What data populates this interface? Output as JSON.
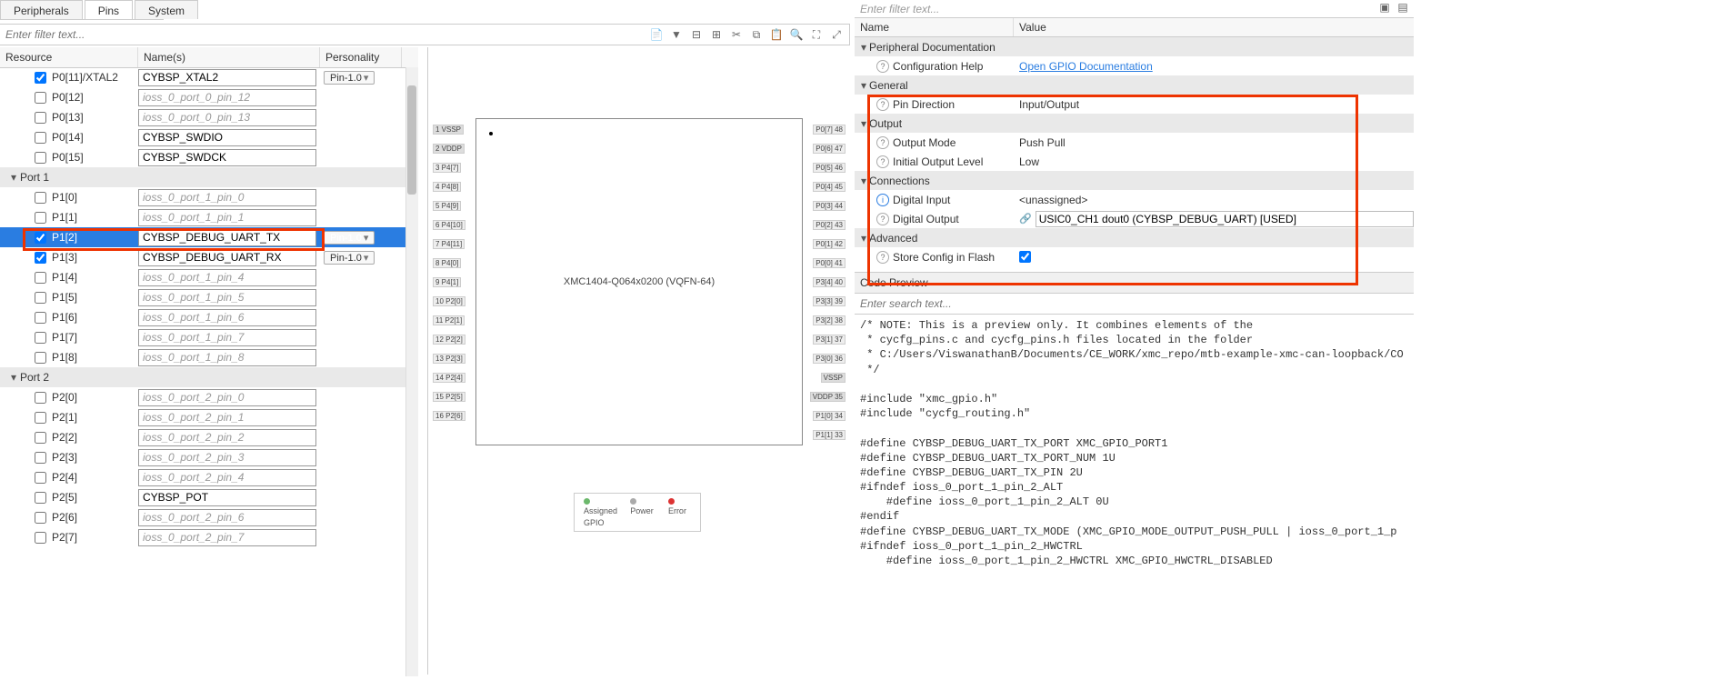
{
  "tabs": {
    "peripherals": "Peripherals",
    "pins": "Pins",
    "system": "System"
  },
  "filter": {
    "placeholder": "Enter filter text..."
  },
  "headers": {
    "resource": "Resource",
    "names": "Name(s)",
    "personality": "Personality"
  },
  "personality_label": "Pin-1.0",
  "rows": [
    {
      "type": "pin",
      "res": "P0[11]/XTAL2",
      "name": "CYBSP_XTAL2",
      "checked": true,
      "pers": true
    },
    {
      "type": "pin",
      "res": "P0[12]",
      "name": "ioss_0_port_0_pin_12",
      "placeholder": true
    },
    {
      "type": "pin",
      "res": "P0[13]",
      "name": "ioss_0_port_0_pin_13",
      "placeholder": true
    },
    {
      "type": "pin",
      "res": "P0[14]",
      "name": "CYBSP_SWDIO"
    },
    {
      "type": "pin",
      "res": "P0[15]",
      "name": "CYBSP_SWDCK"
    },
    {
      "type": "group",
      "res": "Port 1"
    },
    {
      "type": "pin",
      "res": "P1[0]",
      "name": "ioss_0_port_1_pin_0",
      "placeholder": true
    },
    {
      "type": "pin",
      "res": "P1[1]",
      "name": "ioss_0_port_1_pin_1",
      "placeholder": true
    },
    {
      "type": "pin",
      "res": "P1[2]",
      "name": "CYBSP_DEBUG_UART_TX",
      "checked": true,
      "pers": true,
      "sel": true
    },
    {
      "type": "pin",
      "res": "P1[3]",
      "name": "CYBSP_DEBUG_UART_RX",
      "checked": true,
      "pers": true
    },
    {
      "type": "pin",
      "res": "P1[4]",
      "name": "ioss_0_port_1_pin_4",
      "placeholder": true
    },
    {
      "type": "pin",
      "res": "P1[5]",
      "name": "ioss_0_port_1_pin_5",
      "placeholder": true
    },
    {
      "type": "pin",
      "res": "P1[6]",
      "name": "ioss_0_port_1_pin_6",
      "placeholder": true
    },
    {
      "type": "pin",
      "res": "P1[7]",
      "name": "ioss_0_port_1_pin_7",
      "placeholder": true
    },
    {
      "type": "pin",
      "res": "P1[8]",
      "name": "ioss_0_port_1_pin_8",
      "placeholder": true
    },
    {
      "type": "group",
      "res": "Port 2"
    },
    {
      "type": "pin",
      "res": "P2[0]",
      "name": "ioss_0_port_2_pin_0",
      "placeholder": true
    },
    {
      "type": "pin",
      "res": "P2[1]",
      "name": "ioss_0_port_2_pin_1",
      "placeholder": true
    },
    {
      "type": "pin",
      "res": "P2[2]",
      "name": "ioss_0_port_2_pin_2",
      "placeholder": true
    },
    {
      "type": "pin",
      "res": "P2[3]",
      "name": "ioss_0_port_2_pin_3",
      "placeholder": true
    },
    {
      "type": "pin",
      "res": "P2[4]",
      "name": "ioss_0_port_2_pin_4",
      "placeholder": true
    },
    {
      "type": "pin",
      "res": "P2[5]",
      "name": "CYBSP_POT"
    },
    {
      "type": "pin",
      "res": "P2[6]",
      "name": "ioss_0_port_2_pin_6",
      "placeholder": true
    },
    {
      "type": "pin",
      "res": "P2[7]",
      "name": "ioss_0_port_2_pin_7",
      "placeholder": true
    }
  ],
  "chip": {
    "title": "XMC1404-Q064x0200 (VQFN-64)",
    "legend": {
      "assigned": "Assigned",
      "power": "Power",
      "error": "Error",
      "gpio": "GPIO"
    },
    "right_pins": [
      {
        "lbl": "P0[7]",
        "num": "48"
      },
      {
        "lbl": "P0[6]",
        "num": "47"
      },
      {
        "lbl": "P0[5]",
        "num": "46"
      },
      {
        "lbl": "P0[4]",
        "num": "45"
      },
      {
        "lbl": "P0[3]",
        "num": "44"
      },
      {
        "lbl": "P0[2]",
        "num": "43"
      },
      {
        "lbl": "P0[1]",
        "num": "42"
      },
      {
        "lbl": "P0[0]",
        "num": "41"
      },
      {
        "lbl": "P3[4]",
        "num": "40"
      },
      {
        "lbl": "P3[3]",
        "num": "39"
      },
      {
        "lbl": "P3[2]",
        "num": "38"
      },
      {
        "lbl": "P3[1]",
        "num": "37"
      },
      {
        "lbl": "P3[0]",
        "num": "36"
      },
      {
        "lbl": "VSSP",
        "num": null,
        "power": true
      },
      {
        "lbl": "VDDP",
        "num": "35",
        "power": true
      },
      {
        "lbl": "P1[0]",
        "num": "34"
      },
      {
        "lbl": "P1[1]",
        "num": "33"
      }
    ],
    "left_pins": [
      {
        "num": "1",
        "lbl": "VSSP",
        "power": true
      },
      {
        "num": "2",
        "lbl": "VDDP",
        "power": true
      },
      {
        "num": "3",
        "lbl": "P4[7]"
      },
      {
        "num": "4",
        "lbl": "P4[8]"
      },
      {
        "num": "5",
        "lbl": "P4[9]"
      },
      {
        "num": "6",
        "lbl": "P4[10]"
      },
      {
        "num": "7",
        "lbl": "P4[11]"
      },
      {
        "num": "8",
        "lbl": "P4[0]"
      },
      {
        "num": "9",
        "lbl": "P4[1]"
      },
      {
        "num": "10",
        "lbl": "P2[0]"
      },
      {
        "num": "11",
        "lbl": "P2[1]"
      },
      {
        "num": "12",
        "lbl": "P2[2]"
      },
      {
        "num": "13",
        "lbl": "P2[3]"
      },
      {
        "num": "14",
        "lbl": "P2[4]"
      },
      {
        "num": "15",
        "lbl": "P2[5]"
      },
      {
        "num": "16",
        "lbl": "P2[6]"
      }
    ]
  },
  "props": {
    "filter_placeholder": "Enter filter text...",
    "hdr_name": "Name",
    "hdr_value": "Value",
    "periph_doc": "Peripheral Documentation",
    "config_help": "Configuration Help",
    "config_help_link": "Open GPIO Documentation",
    "general": "General",
    "pin_dir": "Pin Direction",
    "pin_dir_val": "Input/Output",
    "output": "Output",
    "output_mode": "Output Mode",
    "output_mode_val": "Push Pull",
    "init_level": "Initial Output Level",
    "init_level_val": "Low",
    "connections": "Connections",
    "dig_in": "Digital Input",
    "dig_in_val": "<unassigned>",
    "dig_out": "Digital Output",
    "dig_out_val": "USIC0_CH1 dout0 (CYBSP_DEBUG_UART) [USED]",
    "advanced": "Advanced",
    "store_cfg": "Store Config in Flash"
  },
  "code_preview": {
    "header": "Code Preview",
    "search": "Enter search text...",
    "body": "/* NOTE: This is a preview only. It combines elements of the\n * cycfg_pins.c and cycfg_pins.h files located in the folder\n * C:/Users/ViswanathanB/Documents/CE_WORK/xmc_repo/mtb-example-xmc-can-loopback/CO\n */\n\n#include \"xmc_gpio.h\"\n#include \"cycfg_routing.h\"\n\n#define CYBSP_DEBUG_UART_TX_PORT XMC_GPIO_PORT1\n#define CYBSP_DEBUG_UART_TX_PORT_NUM 1U\n#define CYBSP_DEBUG_UART_TX_PIN 2U\n#ifndef ioss_0_port_1_pin_2_ALT\n    #define ioss_0_port_1_pin_2_ALT 0U\n#endif\n#define CYBSP_DEBUG_UART_TX_MODE (XMC_GPIO_MODE_OUTPUT_PUSH_PULL | ioss_0_port_1_p\n#ifndef ioss_0_port_1_pin_2_HWCTRL\n    #define ioss_0_port_1_pin_2_HWCTRL XMC_GPIO_HWCTRL_DISABLED"
  }
}
